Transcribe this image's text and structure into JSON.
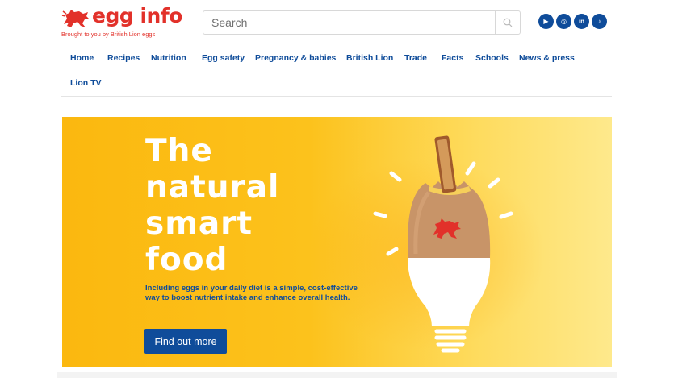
{
  "brand": {
    "name": "egg info",
    "tagline": "Brought to you by British Lion eggs",
    "color": "#e2312a"
  },
  "search": {
    "placeholder": "Search",
    "value": ""
  },
  "social": [
    {
      "icon": "youtube-icon",
      "glyph": "▶"
    },
    {
      "icon": "instagram-icon",
      "glyph": "◎"
    },
    {
      "icon": "linkedin-icon",
      "glyph": "in"
    },
    {
      "icon": "tiktok-icon",
      "glyph": "♪"
    }
  ],
  "nav": {
    "items": [
      "Home",
      "Recipes",
      "Nutrition",
      "Egg safety",
      "Pregnancy & babies",
      "British Lion",
      "Trade",
      "Facts",
      "Schools",
      "News & press",
      "Lion TV"
    ],
    "color": "#0f4c9a"
  },
  "hero": {
    "title_lines": [
      "The",
      "natural",
      "smart",
      "food"
    ],
    "description": "Including eggs in your daily diet is a simple, cost-effective way to boost nutrient intake and enhance overall health.",
    "cta_label": "Find out more",
    "accent": "#fbb80f"
  }
}
